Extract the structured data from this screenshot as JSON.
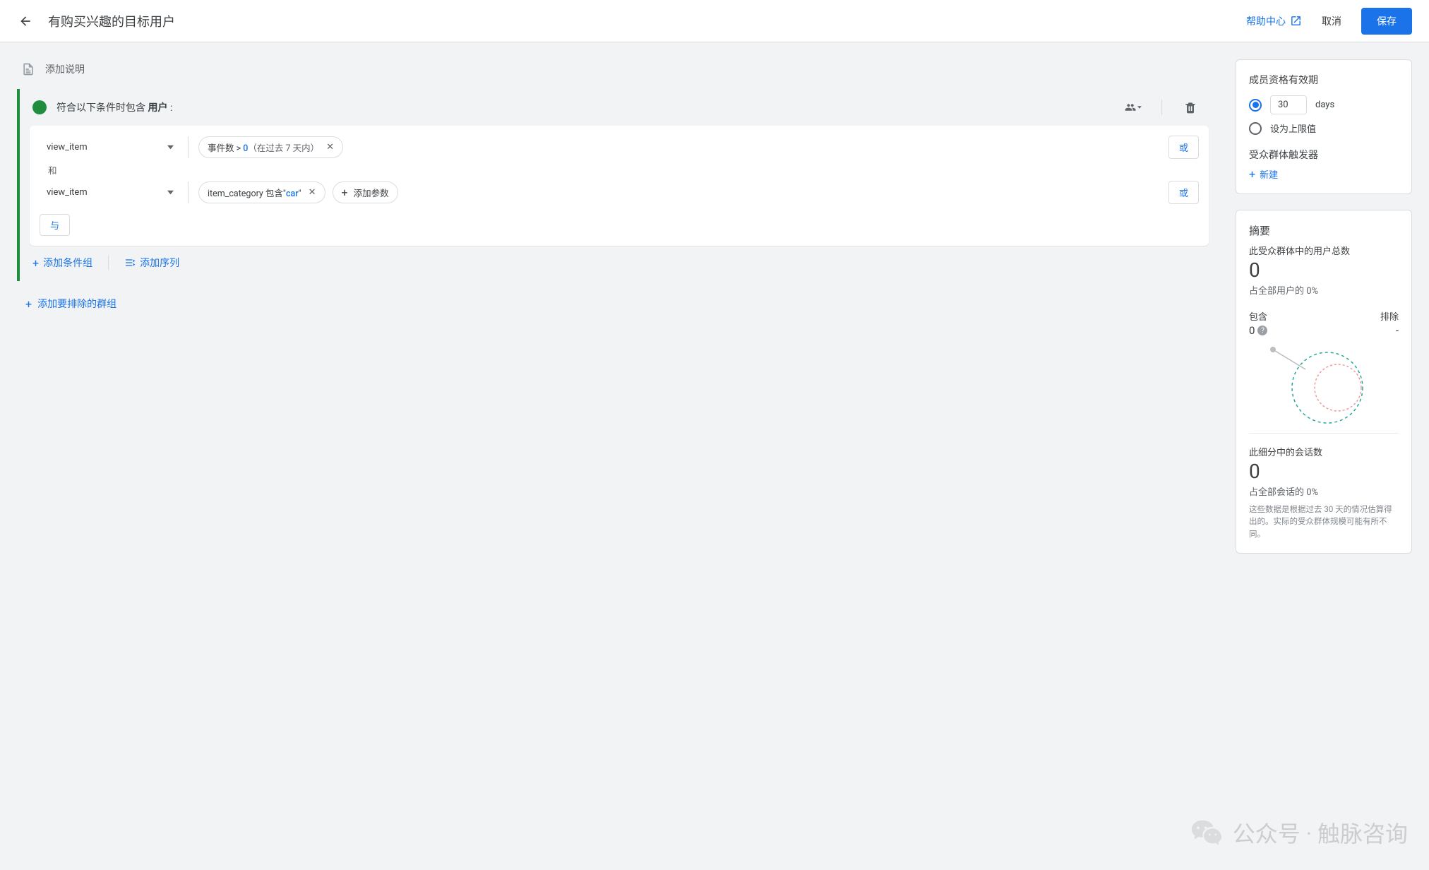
{
  "header": {
    "title": "有购买兴趣的目标用户",
    "help_link": "帮助中心",
    "cancel": "取消",
    "save": "保存"
  },
  "description": {
    "placeholder": "添加说明"
  },
  "group": {
    "title_prefix": "符合以下条件时包含 ",
    "title_bold": "用户",
    "title_suffix": " :",
    "conditions": [
      {
        "event": "view_item",
        "chip_html": "<span>事件数 &gt; </span><span class='blue'>0</span><span class='mute'>（在过去 7 天内）</span>",
        "or_label": "或"
      },
      {
        "event": "view_item",
        "chip_html": "<span>item_category 包含\"</span><span class='blue'>car</span><span>\"</span>",
        "add_param": "添加参数",
        "or_label": "或"
      }
    ],
    "and_label": "和",
    "and_button": "与",
    "footer": {
      "add_group": "添加条件组",
      "add_seq": "添加序列"
    }
  },
  "add_exclude": "添加要排除的群组",
  "membership": {
    "title": "成员资格有效期",
    "days_value": "30",
    "days_unit": "days",
    "max_label": "设为上限值",
    "trigger_title": "受众群体触发器",
    "new_label": "新建"
  },
  "summary": {
    "title": "摘要",
    "users_label": "此受众群体中的用户总数",
    "users_value": "0",
    "users_pct": "占全部用户的 0%",
    "include_label": "包含",
    "include_value": "0",
    "exclude_label": "排除",
    "exclude_value": "-",
    "sessions_label": "此细分中的会话数",
    "sessions_value": "0",
    "sessions_pct": "占全部会话的 0%",
    "note": "这些数据是根据过去 30 天的情况估算得出的。实际的受众群体规模可能有所不同。"
  },
  "watermark": "公众号 · 触脉咨询"
}
